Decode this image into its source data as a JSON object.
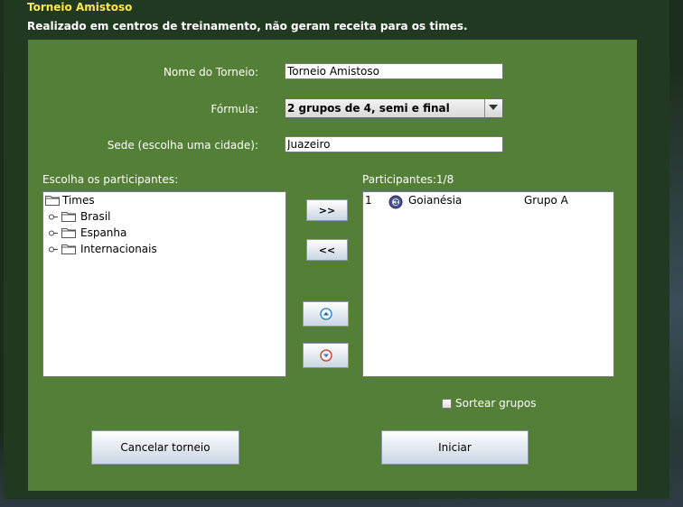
{
  "dialog": {
    "title": "Torneio Amistoso",
    "subtitle": "Realizado em centros de treinamento, não geram receita para os times."
  },
  "form": {
    "name_label": "Nome do Torneio:",
    "name_value": "Torneio Amistoso",
    "formula_label": "Fórmula:",
    "formula_value": "2 grupos de 4, semi e final",
    "venue_label": "Sede (escolha uma cidade):",
    "venue_value": "Juazeiro"
  },
  "selection": {
    "choose_label": "Escolha os participantes:",
    "tree": {
      "root": "Times",
      "children": [
        "Brasil",
        "Espanha",
        "Internacionais"
      ]
    },
    "participants_label": "Participantes:1/8",
    "participants": [
      {
        "index": "1",
        "team": "Goianésia",
        "group": "Grupo A"
      }
    ]
  },
  "buttons": {
    "add": ">>",
    "remove": "<<",
    "up_icon": "arrow-up-circle-icon",
    "down_icon": "arrow-down-circle-icon",
    "cancel": "Cancelar torneio",
    "start": "Iniciar"
  },
  "options": {
    "draw_groups_label": "Sortear grupos",
    "draw_groups_checked": false
  },
  "colors": {
    "title": "#ffe84a",
    "panel": "#537f36",
    "dialog": "#213821"
  }
}
